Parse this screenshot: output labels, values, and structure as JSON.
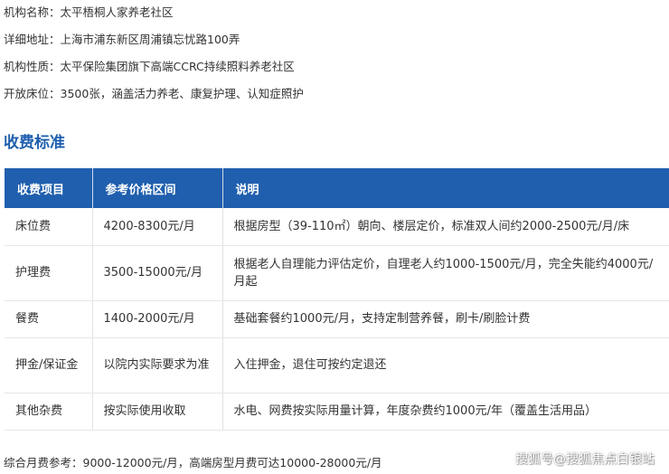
{
  "info": [
    {
      "label": "机构名称：",
      "value": "太平梧桐人家养老社区"
    },
    {
      "label": "详细地址：",
      "value": "上海市浦东新区周浦镇忘忧路100弄"
    },
    {
      "label": "机构性质：",
      "value": "太平保险集团旗下高端CCRC持续照料养老社区"
    },
    {
      "label": "开放床位：",
      "value": "3500张，涵盖活力养老、康复护理、认知症照护"
    }
  ],
  "section_title": "收费标准",
  "table": {
    "headers": [
      "收费项目",
      "参考价格区间",
      "说明"
    ],
    "rows": [
      [
        "床位费",
        "4200-8300元/月",
        "根据房型（39-110㎡）朝向、楼层定价，标准双人间约2000-2500元/月/床"
      ],
      [
        "护理费",
        "3500-15000元/月",
        "根据老人自理能力评估定价，自理老人约1000-1500元/月，完全失能约4000元/月起"
      ],
      [
        "餐费",
        "1400-2000元/月",
        "基础套餐约1000元/月，支持定制营养餐，刷卡/刷脸计费"
      ],
      [
        "押金/保证金",
        "以院内实际要求为准",
        "入住押金，退住可按约定退还"
      ],
      [
        "其他杂费",
        "按实际使用收取",
        "水电、网费按实际用量计算，年度杂费约1000元/年（覆盖生活用品）"
      ]
    ]
  },
  "footer": "综合月费参考：9000-12000元/月，高端房型月费可达10000-28000元/月",
  "watermark": "搜狐号@搜狐焦点白银站",
  "colors": {
    "accent": "#1f5fae"
  }
}
